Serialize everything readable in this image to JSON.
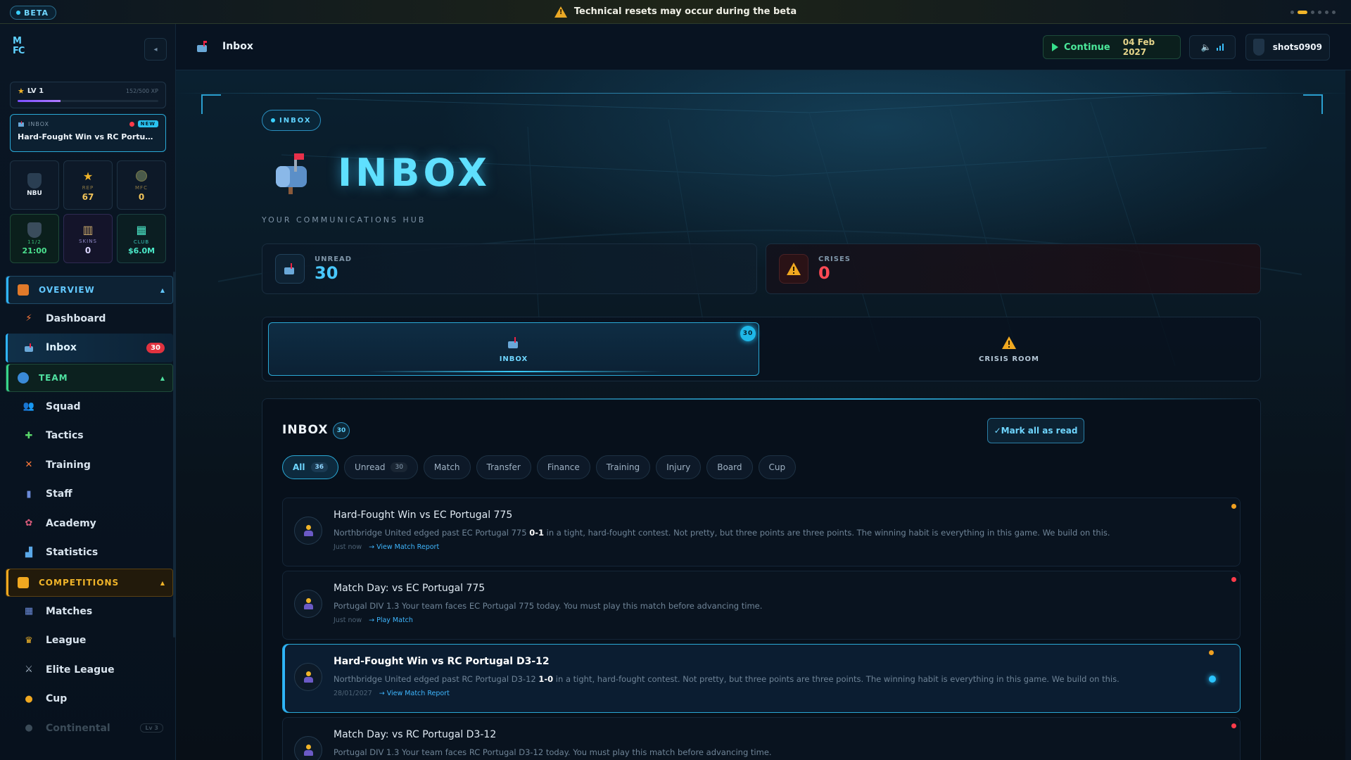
{
  "beta_bar": {
    "pill": "BETA",
    "message": "Technical resets may occur during the beta"
  },
  "sidebar": {
    "logo": "MFC",
    "level": {
      "label": "LV 1",
      "xp": "152/500 XP",
      "progress": 0.304
    },
    "notification": {
      "category": "INBOX",
      "badge": "NEW",
      "title": "Hard-Fought Win vs RC Portugal D3..."
    },
    "tiles": [
      {
        "label": "",
        "value": "NBU"
      },
      {
        "label": "REP",
        "value": "67"
      },
      {
        "label": "MFC",
        "value": "0"
      },
      {
        "label": "11/2",
        "value": "21:00"
      },
      {
        "label": "SKINS",
        "value": "0"
      },
      {
        "label": "CLUB",
        "value": "$6.0M"
      }
    ],
    "sections": [
      {
        "title": "OVERVIEW",
        "items": [
          {
            "label": "Dashboard"
          },
          {
            "label": "Inbox",
            "badge": "30"
          }
        ]
      },
      {
        "title": "TEAM",
        "items": [
          {
            "label": "Squad"
          },
          {
            "label": "Tactics"
          },
          {
            "label": "Training"
          },
          {
            "label": "Staff"
          },
          {
            "label": "Academy"
          },
          {
            "label": "Statistics"
          }
        ]
      },
      {
        "title": "COMPETITIONS",
        "items": [
          {
            "label": "Matches"
          },
          {
            "label": "League"
          },
          {
            "label": "Elite League"
          },
          {
            "label": "Cup"
          },
          {
            "label": "Continental",
            "tag": "Lv 3"
          }
        ]
      }
    ]
  },
  "header": {
    "title": "Inbox",
    "continue_label": "Continue",
    "date": "04 Feb 2027",
    "username": "shots0909"
  },
  "hero": {
    "pill": "INBOX",
    "title": "INBOX",
    "subtitle": "YOUR COMMUNICATIONS HUB"
  },
  "stats": [
    {
      "label": "UNREAD",
      "value": "30"
    },
    {
      "label": "CRISES",
      "value": "0"
    }
  ],
  "tabs": [
    {
      "label": "INBOX",
      "badge": "30"
    },
    {
      "label": "CRISIS ROOM"
    }
  ],
  "panel": {
    "title": "INBOX",
    "count": "30",
    "mark_all": "✓Mark all as read",
    "filters": [
      {
        "label": "All",
        "count": "36"
      },
      {
        "label": "Unread",
        "count": "30"
      },
      {
        "label": "Match"
      },
      {
        "label": "Transfer"
      },
      {
        "label": "Finance"
      },
      {
        "label": "Training"
      },
      {
        "label": "Injury"
      },
      {
        "label": "Board"
      },
      {
        "label": "Cup"
      }
    ],
    "messages": [
      {
        "title": "Hard-Fought Win vs EC Portugal 775",
        "body_pre": "Northbridge United edged past EC Portugal 775 ",
        "score": "0-1",
        "body_post": " in a tight, hard-fought contest. Not pretty, but three points are three points. The winning habit is everything in this game. We build on this.",
        "time": "Just now",
        "link": "→ View Match Report",
        "priority_color": "#f0a020"
      },
      {
        "title": "Match Day: vs EC Portugal 775",
        "body_pre": "Portugal DIV 1.3 Your team faces EC Portugal 775 today. You must play this match before advancing time.",
        "score": "",
        "body_post": "",
        "time": "Just now",
        "link": "→ Play Match",
        "priority_color": "#ff3b4a"
      },
      {
        "title": "Hard-Fought Win vs RC Portugal D3-12",
        "body_pre": "Northbridge United edged past RC Portugal D3-12 ",
        "score": "1-0",
        "body_post": " in a tight, hard-fought contest. Not pretty, but three points are three points. The winning habit is everything in this game. We build on this.",
        "time": "28/01/2027",
        "link": "→ View Match Report",
        "priority_color": "#f0a020"
      },
      {
        "title": "Match Day: vs RC Portugal D3-12",
        "body_pre": "Portugal DIV 1.3 Your team faces RC Portugal D3-12 today. You must play this match before advancing time.",
        "score": "",
        "body_post": "",
        "time": "",
        "link": "",
        "priority_color": "#ff3b4a"
      }
    ]
  }
}
